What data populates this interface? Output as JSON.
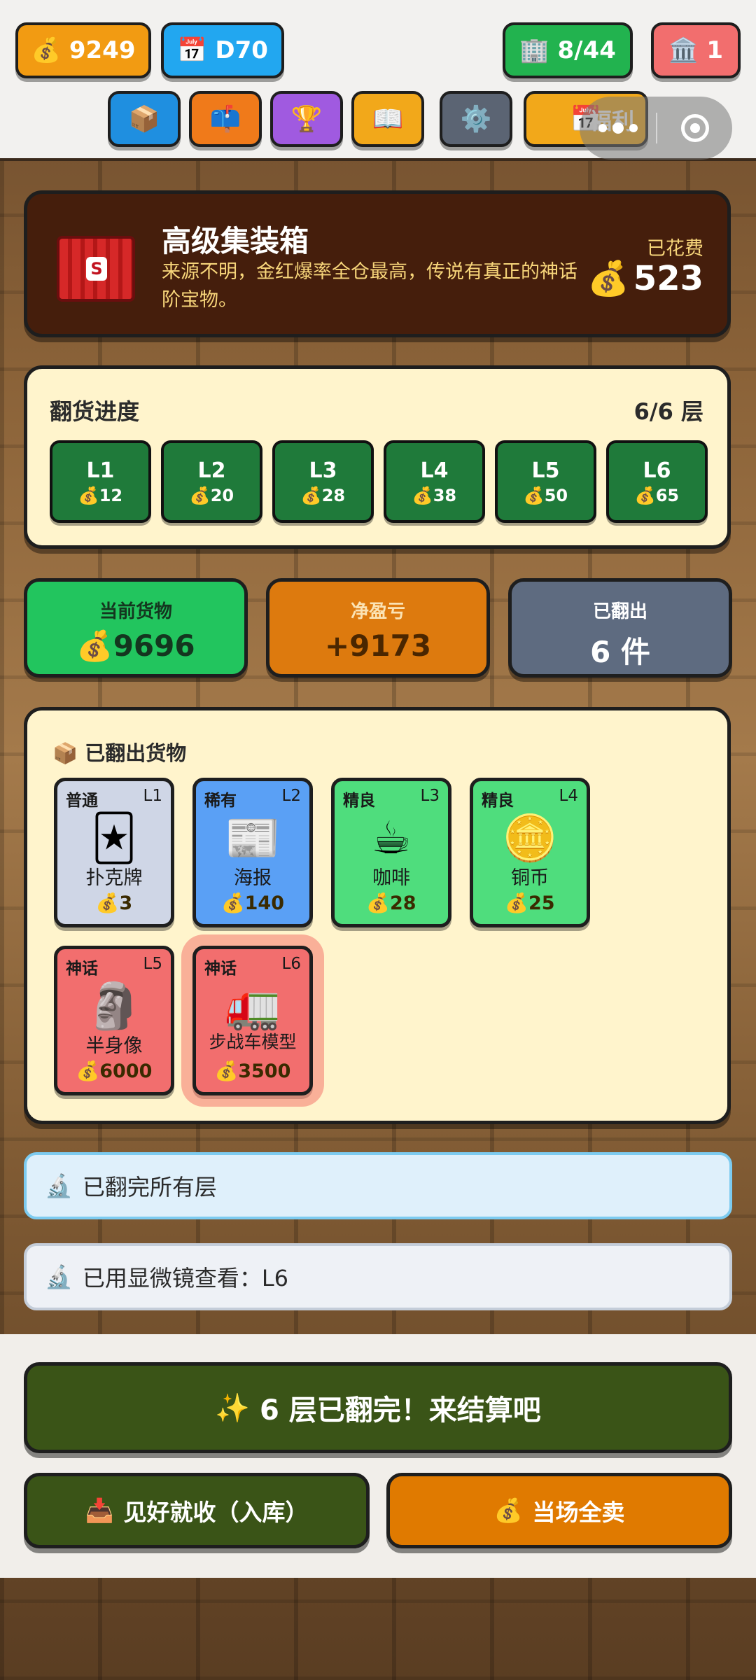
{
  "header": {
    "coins": "9249",
    "day": "D70",
    "buildings": "8/44",
    "bank": "1",
    "welfare_label": "福利",
    "toolbar": [
      {
        "icon": "package-icon",
        "glyph": "📦",
        "color": "#1f8fe0"
      },
      {
        "icon": "mailbox-icon",
        "glyph": "📫",
        "color": "#f07a1a"
      },
      {
        "icon": "trophy-icon",
        "glyph": "🏆",
        "color": "#a05ae0"
      },
      {
        "icon": "book-icon",
        "glyph": "📖",
        "color": "#f2a81a"
      },
      {
        "icon": "gear-icon",
        "glyph": "⚙️",
        "color": "#5b6473"
      },
      {
        "icon": "calendar-icon",
        "glyph": "📅",
        "color": "#f2a81a"
      }
    ]
  },
  "crate": {
    "title": "高级集装箱",
    "description": "来源不明，金红爆率全仓最高，传说有真正的神话阶宝物。",
    "spent_label": "已花费",
    "spent_value": "523"
  },
  "progress": {
    "title": "翻货进度",
    "count": "6/6 层",
    "layers": [
      {
        "name": "L1",
        "cost": "12"
      },
      {
        "name": "L2",
        "cost": "20"
      },
      {
        "name": "L3",
        "cost": "28"
      },
      {
        "name": "L4",
        "cost": "38"
      },
      {
        "name": "L5",
        "cost": "50"
      },
      {
        "name": "L6",
        "cost": "65"
      }
    ]
  },
  "stats": {
    "current_label": "当前货物",
    "current_value": "9696",
    "net_label": "净盈亏",
    "net_value": "+9173",
    "flipped_label": "已翻出",
    "flipped_value": "6 件"
  },
  "items": {
    "title": "已翻出货物",
    "list": [
      {
        "rarity": "普通",
        "level": "L1",
        "name": "扑克牌",
        "price": "3",
        "icon": "joker-card-icon",
        "glyph": "🃏",
        "color": "#cfd6e6"
      },
      {
        "rarity": "稀有",
        "level": "L2",
        "name": "海报",
        "price": "140",
        "icon": "newspaper-icon",
        "glyph": "📰",
        "color": "#5aa0f5"
      },
      {
        "rarity": "精良",
        "level": "L3",
        "name": "咖啡",
        "price": "28",
        "icon": "coffee-icon",
        "glyph": "☕",
        "color": "#4fdd7d"
      },
      {
        "rarity": "精良",
        "level": "L4",
        "name": "铜币",
        "price": "25",
        "icon": "coin-icon",
        "glyph": "🪙",
        "color": "#4fdd7d"
      },
      {
        "rarity": "神话",
        "level": "L5",
        "name": "半身像",
        "price": "6000",
        "icon": "moai-icon",
        "glyph": "🗿",
        "color": "#f26e6e"
      },
      {
        "rarity": "神话",
        "level": "L6",
        "name": "步战车模型",
        "price": "3500",
        "icon": "truck-icon",
        "glyph": "🚛",
        "color": "#f26e6e"
      }
    ]
  },
  "notices": {
    "all_done": "已翻完所有层",
    "microscope": "已用显微镜查看：L6"
  },
  "actions": {
    "settle": "6 层已翻完！来结算吧",
    "store": "见好就收（入库）",
    "sell_all": "当场全卖"
  }
}
